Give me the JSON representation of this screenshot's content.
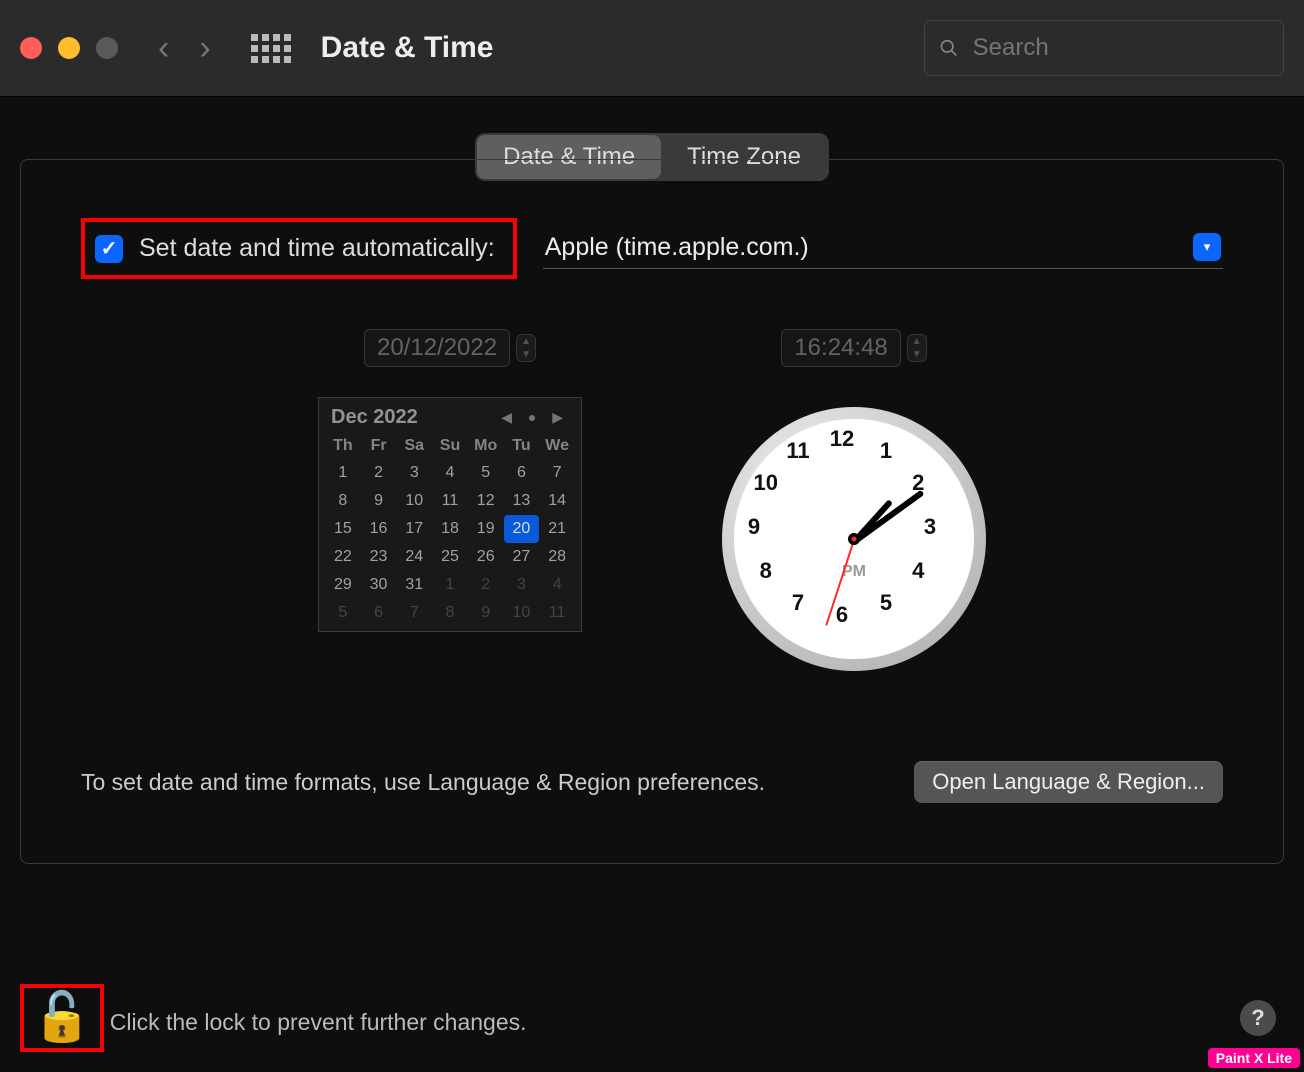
{
  "toolbar": {
    "title": "Date & Time",
    "search_placeholder": "Search"
  },
  "tabs": {
    "date_time": "Date & Time",
    "time_zone": "Time Zone"
  },
  "auto": {
    "label": "Set date and time automatically:",
    "checked": true,
    "server": "Apple (time.apple.com.)"
  },
  "date_field": "20/12/2022",
  "time_field": "16:24:48",
  "calendar": {
    "title": "Dec 2022",
    "dow": [
      "Th",
      "Fr",
      "Sa",
      "Su",
      "Mo",
      "Tu",
      "We"
    ],
    "weeks": [
      [
        {
          "n": "1"
        },
        {
          "n": "2"
        },
        {
          "n": "3"
        },
        {
          "n": "4"
        },
        {
          "n": "5"
        },
        {
          "n": "6"
        },
        {
          "n": "7"
        }
      ],
      [
        {
          "n": "8"
        },
        {
          "n": "9"
        },
        {
          "n": "10"
        },
        {
          "n": "11"
        },
        {
          "n": "12"
        },
        {
          "n": "13"
        },
        {
          "n": "14"
        }
      ],
      [
        {
          "n": "15"
        },
        {
          "n": "16"
        },
        {
          "n": "17"
        },
        {
          "n": "18"
        },
        {
          "n": "19"
        },
        {
          "n": "20",
          "sel": true
        },
        {
          "n": "21"
        }
      ],
      [
        {
          "n": "22"
        },
        {
          "n": "23"
        },
        {
          "n": "24"
        },
        {
          "n": "25"
        },
        {
          "n": "26"
        },
        {
          "n": "27"
        },
        {
          "n": "28"
        }
      ],
      [
        {
          "n": "29"
        },
        {
          "n": "30"
        },
        {
          "n": "31"
        },
        {
          "n": "1",
          "dim": true
        },
        {
          "n": "2",
          "dim": true
        },
        {
          "n": "3",
          "dim": true
        },
        {
          "n": "4",
          "dim": true
        }
      ],
      [
        {
          "n": "5",
          "dim": true
        },
        {
          "n": "6",
          "dim": true
        },
        {
          "n": "7",
          "dim": true
        },
        {
          "n": "8",
          "dim": true
        },
        {
          "n": "9",
          "dim": true
        },
        {
          "n": "10",
          "dim": true
        },
        {
          "n": "11",
          "dim": true
        }
      ]
    ]
  },
  "clock": {
    "ampm": "PM",
    "numbers": [
      "12",
      "1",
      "2",
      "3",
      "4",
      "5",
      "6",
      "7",
      "8",
      "9",
      "10",
      "11"
    ],
    "hour_angle": 42,
    "minute_angle": 54,
    "second_angle": 198
  },
  "footer": {
    "text": "To set date and time formats, use Language & Region preferences.",
    "button": "Open Language & Region..."
  },
  "lock": {
    "text": "Click the lock to prevent further changes."
  },
  "watermark": "Paint X Lite"
}
